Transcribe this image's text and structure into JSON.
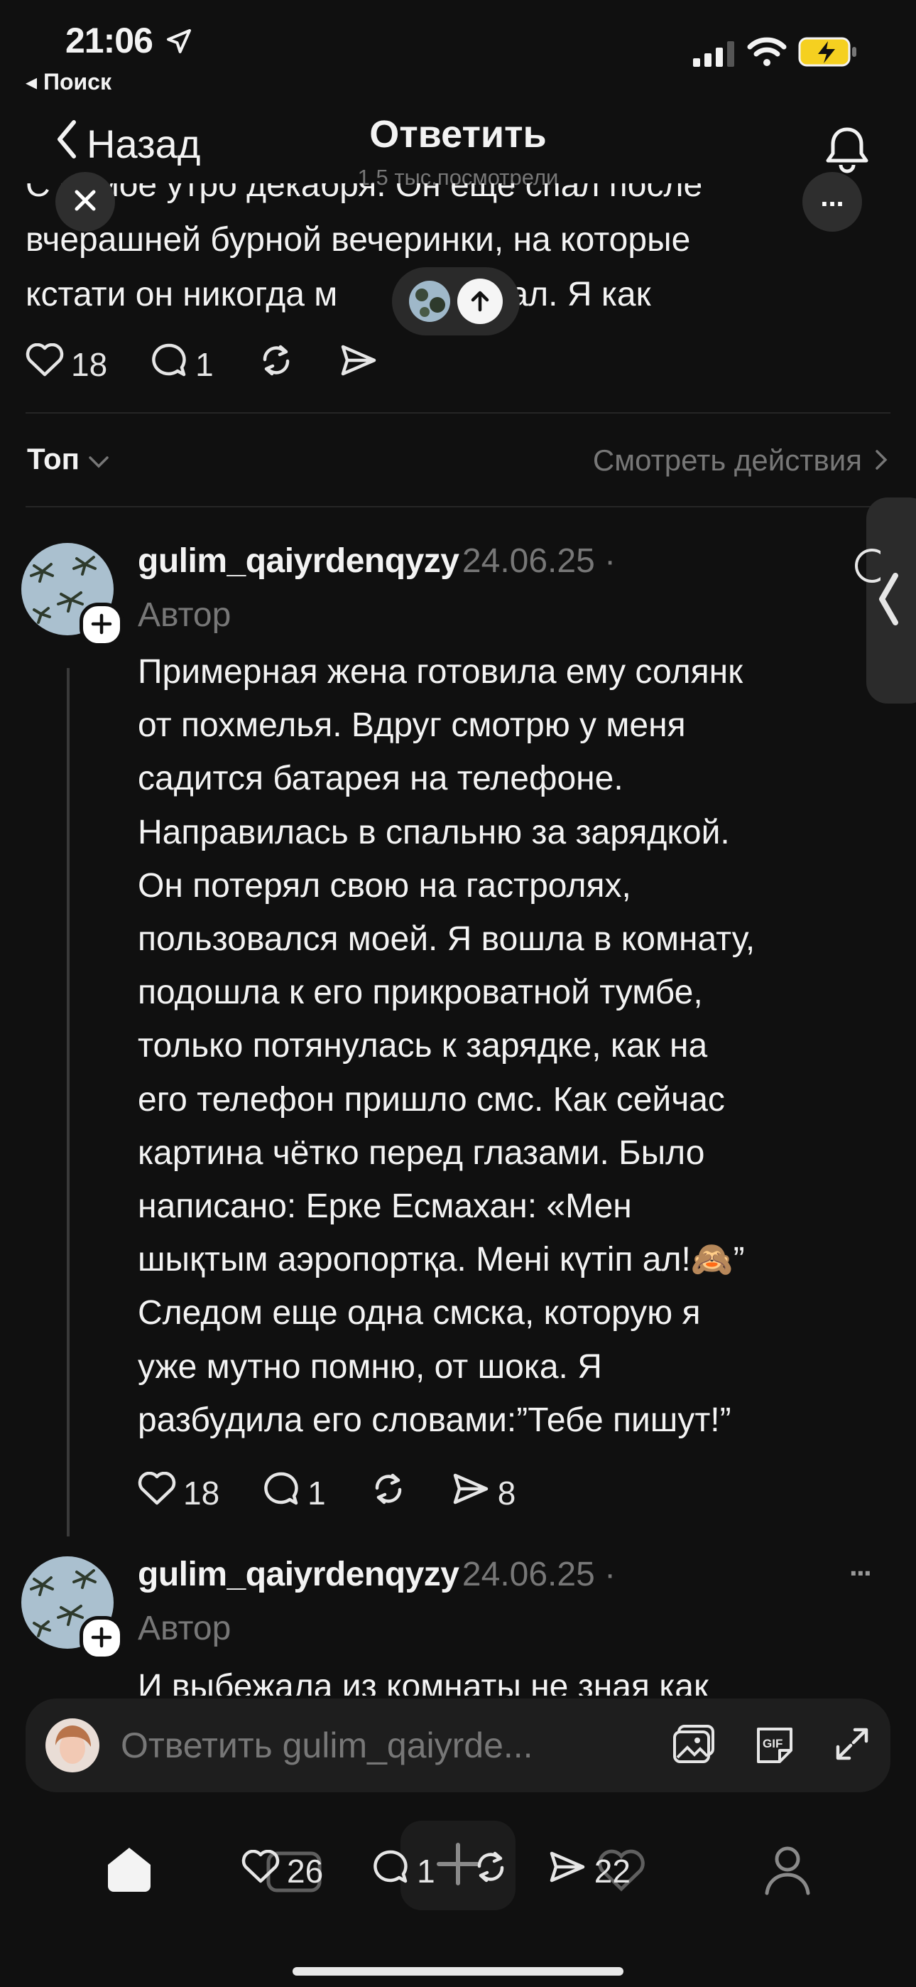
{
  "status_bar": {
    "time": "21:06",
    "back_app": "◂ Поиск"
  },
  "nav": {
    "back_label": "Назад",
    "title": "Ответить",
    "views": "1,5 тыс.посмотрели"
  },
  "preview": {
    "line1": "С самое утро декабря. Он еще спал после",
    "line2": "вчерашней бурной вечеринки, на которые",
    "line3a": "кстати он никогда м",
    "line3b": "е брал. Я как",
    "likes": "18",
    "replies": "1",
    "more": "..."
  },
  "sort": {
    "label": "Топ",
    "view_activity": "Смотреть действия"
  },
  "posts": [
    {
      "username": "gulim_qaiyrdenqyzy",
      "date": "24.06.25 ·",
      "role": "Автор",
      "text": "Примерная жена готовила ему солянк\nот похмелья. Вдруг смотрю у меня\nсадится батарея на телефоне.\nНаправилась в спальню за зарядкой.\nОн потерял свою на гастролях,\nпользовался моей. Я вошла в комнату,\nподошла к его прикроватной тумбе,\nтолько потянулась к зарядке, как на\nего телефон пришло смс. Как сейчас\nкартина чётко перед глазами. Было\nнаписано: Ерке Есмахан: «Мен\nшықтым аэропортқа. Мені күтіп ал!🙈”\nСледом еще одна смска, которую я\nуже мутно помню, от шока. Я\nразбудила его словами:”Тебе пишут!”",
      "likes": "18",
      "replies": "1",
      "shares": "8"
    },
    {
      "username": "gulim_qaiyrdenqyzy",
      "date": "24.06.25 ·",
      "role": "Автор",
      "text": "И выбежала из комнаты не зная как",
      "more": "···"
    }
  ],
  "reply_bar": {
    "placeholder": "Ответить gulim_qaiyrde..."
  },
  "tabbar": {
    "likes": "26",
    "replies": "1",
    "shares": "22"
  },
  "colors": {
    "background": "#101010",
    "text": "#f3f3f3",
    "muted": "#777777",
    "battery": "#f5d020"
  }
}
